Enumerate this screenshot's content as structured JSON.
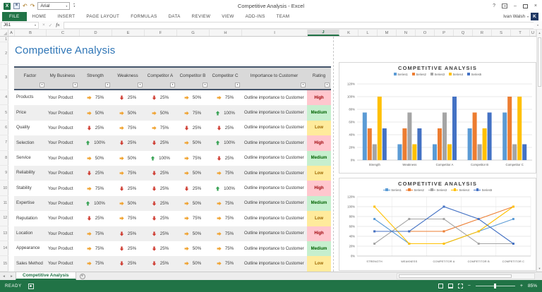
{
  "window": {
    "title": "Competitive Analysis - Excel",
    "user_name": "Ivan Walsh",
    "avatar_initial": "K"
  },
  "quick_access": {
    "font_name": "Arial"
  },
  "icons": {
    "excel_logo": "X",
    "dropdown": "▾",
    "filter": "▾",
    "help": "?",
    "minimize": "–",
    "close": "×",
    "undo": "↶",
    "redo": "↷",
    "cancel": "×",
    "enter": "✓",
    "fx": "fx",
    "scroll_up": "▲",
    "scroll_down": "▼",
    "tab_prev": "◂",
    "tab_next": "▸"
  },
  "ribbon": {
    "tabs": [
      "FILE",
      "HOME",
      "INSERT",
      "PAGE LAYOUT",
      "FORMULAS",
      "DATA",
      "REVIEW",
      "VIEW",
      "ADD-INS",
      "TEAM"
    ]
  },
  "formula_bar": {
    "name_box": "J61",
    "value": ""
  },
  "grid": {
    "columns": [
      "A",
      "B",
      "C",
      "D",
      "E",
      "F",
      "G",
      "H",
      "I",
      "J",
      "K",
      "L",
      "M",
      "N",
      "O",
      "P",
      "Q",
      "R",
      "S",
      "T",
      "U"
    ],
    "selected_column": "J",
    "rows": [
      "1",
      "2",
      "3",
      "4",
      "5",
      "6",
      "7",
      "8",
      "9",
      "10",
      "11",
      "12",
      "13",
      "14",
      "15"
    ]
  },
  "sheet": {
    "title": "Competitive Analysis",
    "table": {
      "headers": [
        "Factor",
        "My Business",
        "Strength",
        "Weakness",
        "Competitor A",
        "Competitor B",
        "Competitor C",
        "Importance to Customer",
        "Rating"
      ],
      "rows": [
        {
          "factor": "Products",
          "business": "Your Product",
          "metrics": [
            {
              "trend": "right",
              "value": "75%"
            },
            {
              "trend": "down",
              "value": "25%"
            },
            {
              "trend": "down",
              "value": "25%"
            },
            {
              "trend": "right",
              "value": "50%"
            },
            {
              "trend": "right",
              "value": "75%"
            }
          ],
          "importance": "Outline importance to Customer",
          "rating": "High"
        },
        {
          "factor": "Price",
          "business": "Your Product",
          "metrics": [
            {
              "trend": "right",
              "value": "50%"
            },
            {
              "trend": "right",
              "value": "50%"
            },
            {
              "trend": "right",
              "value": "50%"
            },
            {
              "trend": "right",
              "value": "75%"
            },
            {
              "trend": "up",
              "value": "100%"
            }
          ],
          "importance": "Outline importance to Customer",
          "rating": "Medium"
        },
        {
          "factor": "Quality",
          "business": "Your Product",
          "metrics": [
            {
              "trend": "down",
              "value": "25%"
            },
            {
              "trend": "right",
              "value": "75%"
            },
            {
              "trend": "right",
              "value": "75%"
            },
            {
              "trend": "down",
              "value": "25%"
            },
            {
              "trend": "down",
              "value": "25%"
            }
          ],
          "importance": "Outline importance to Customer",
          "rating": "Low"
        },
        {
          "factor": "Selection",
          "business": "Your Product",
          "metrics": [
            {
              "trend": "up",
              "value": "100%"
            },
            {
              "trend": "down",
              "value": "25%"
            },
            {
              "trend": "down",
              "value": "25%"
            },
            {
              "trend": "right",
              "value": "50%"
            },
            {
              "trend": "up",
              "value": "100%"
            }
          ],
          "importance": "Outline importance to Customer",
          "rating": "High"
        },
        {
          "factor": "Service",
          "business": "Your Product",
          "metrics": [
            {
              "trend": "right",
              "value": "50%"
            },
            {
              "trend": "right",
              "value": "50%"
            },
            {
              "trend": "up",
              "value": "100%"
            },
            {
              "trend": "right",
              "value": "75%"
            },
            {
              "trend": "down",
              "value": "25%"
            }
          ],
          "importance": "Outline importance to Customer",
          "rating": "Medium"
        },
        {
          "factor": "Reliability",
          "business": "Your Product",
          "metrics": [
            {
              "trend": "down",
              "value": "25%"
            },
            {
              "trend": "right",
              "value": "75%"
            },
            {
              "trend": "down",
              "value": "25%"
            },
            {
              "trend": "right",
              "value": "50%"
            },
            {
              "trend": "right",
              "value": "75%"
            }
          ],
          "importance": "Outline importance to Customer",
          "rating": "Low"
        },
        {
          "factor": "Stability",
          "business": "Your Product",
          "metrics": [
            {
              "trend": "right",
              "value": "75%"
            },
            {
              "trend": "down",
              "value": "25%"
            },
            {
              "trend": "down",
              "value": "25%"
            },
            {
              "trend": "down",
              "value": "25%"
            },
            {
              "trend": "up",
              "value": "100%"
            }
          ],
          "importance": "Outline importance to Customer",
          "rating": "High"
        },
        {
          "factor": "Expertise",
          "business": "Your Product",
          "metrics": [
            {
              "trend": "up",
              "value": "100%"
            },
            {
              "trend": "right",
              "value": "50%"
            },
            {
              "trend": "down",
              "value": "25%"
            },
            {
              "trend": "right",
              "value": "50%"
            },
            {
              "trend": "right",
              "value": "75%"
            }
          ],
          "importance": "Outline importance to Customer",
          "rating": "Medium"
        },
        {
          "factor": "Reputation",
          "business": "Your Product",
          "metrics": [
            {
              "trend": "down",
              "value": "25%"
            },
            {
              "trend": "right",
              "value": "75%"
            },
            {
              "trend": "down",
              "value": "25%"
            },
            {
              "trend": "right",
              "value": "75%"
            },
            {
              "trend": "right",
              "value": "75%"
            }
          ],
          "importance": "Outline importance to Customer",
          "rating": "Low"
        },
        {
          "factor": "Location",
          "business": "Your Product",
          "metrics": [
            {
              "trend": "right",
              "value": "75%"
            },
            {
              "trend": "down",
              "value": "25%"
            },
            {
              "trend": "down",
              "value": "25%"
            },
            {
              "trend": "right",
              "value": "50%"
            },
            {
              "trend": "right",
              "value": "75%"
            }
          ],
          "importance": "Outline importance to Customer",
          "rating": "High"
        },
        {
          "factor": "Appearance",
          "business": "Your Product",
          "metrics": [
            {
              "trend": "right",
              "value": "75%"
            },
            {
              "trend": "down",
              "value": "25%"
            },
            {
              "trend": "down",
              "value": "25%"
            },
            {
              "trend": "right",
              "value": "50%"
            },
            {
              "trend": "right",
              "value": "75%"
            }
          ],
          "importance": "Outline importance to Customer",
          "rating": "Medium"
        },
        {
          "factor": "Sales Method",
          "business": "Your Product",
          "metrics": [
            {
              "trend": "right",
              "value": "75%"
            },
            {
              "trend": "down",
              "value": "25%"
            },
            {
              "trend": "down",
              "value": "25%"
            },
            {
              "trend": "right",
              "value": "50%"
            },
            {
              "trend": "right",
              "value": "75%"
            }
          ],
          "importance": "Outline importance to Customer",
          "rating": "Low"
        }
      ],
      "rating_styles": {
        "High": {
          "bg": "#FFC7CE",
          "fg": "#9C0006"
        },
        "Medium": {
          "bg": "#C6EFCE",
          "fg": "#006100"
        },
        "Low": {
          "bg": "#FFEB9C",
          "fg": "#9C6500"
        }
      },
      "trend_colors": {
        "up": "#33A050",
        "right": "#F0A22E",
        "down": "#CE3A2F"
      }
    }
  },
  "chart_data": [
    {
      "type": "bar",
      "title": "COMPETITIVE ANALYSIS",
      "categories": [
        "Strength",
        "Weakness",
        "Competitor A",
        "Competitor B",
        "Competitor C"
      ],
      "series": [
        {
          "name": "Series1",
          "color": "#5B9BD5",
          "values": [
            75,
            25,
            25,
            50,
            75
          ]
        },
        {
          "name": "Series2",
          "color": "#ED7D31",
          "values": [
            50,
            50,
            50,
            75,
            100
          ]
        },
        {
          "name": "Series3",
          "color": "#A5A5A5",
          "values": [
            25,
            75,
            75,
            25,
            25
          ]
        },
        {
          "name": "Series4",
          "color": "#FFC000",
          "values": [
            100,
            25,
            25,
            50,
            100
          ]
        },
        {
          "name": "Series5",
          "color": "#4472C4",
          "values": [
            50,
            50,
            100,
            75,
            25
          ]
        }
      ],
      "ylim": [
        0,
        120
      ],
      "yticks": [
        "0%",
        "20%",
        "40%",
        "60%",
        "80%",
        "100%",
        "120%"
      ],
      "legend_position": "top",
      "grid": true
    },
    {
      "type": "line",
      "title": "COMPETITIVE ANALYSIS",
      "categories": [
        "STRENGTH",
        "WEAKNESS",
        "COMPETITOR A",
        "COMPETITOR B",
        "COMPETITOR C"
      ],
      "series": [
        {
          "name": "Series1",
          "color": "#5B9BD5",
          "values": [
            75,
            25,
            25,
            50,
            75
          ]
        },
        {
          "name": "Series2",
          "color": "#ED7D31",
          "values": [
            50,
            50,
            50,
            75,
            100
          ]
        },
        {
          "name": "Series3",
          "color": "#A5A5A5",
          "values": [
            25,
            75,
            75,
            25,
            25
          ]
        },
        {
          "name": "Series4",
          "color": "#FFC000",
          "values": [
            100,
            25,
            25,
            50,
            100
          ]
        },
        {
          "name": "Series5",
          "color": "#4472C4",
          "values": [
            50,
            50,
            100,
            75,
            25
          ]
        }
      ],
      "ylim": [
        0,
        120
      ],
      "yticks": [
        "0%",
        "20%",
        "40%",
        "60%",
        "80%",
        "100%",
        "120%"
      ],
      "legend_position": "top",
      "grid": true
    }
  ],
  "sheet_tabs": {
    "active": "Competitive Analysis",
    "add_icon": "+"
  },
  "status_bar": {
    "ready": "READY",
    "zoom_out": "−",
    "zoom_in": "+",
    "zoom_level": "85%"
  }
}
